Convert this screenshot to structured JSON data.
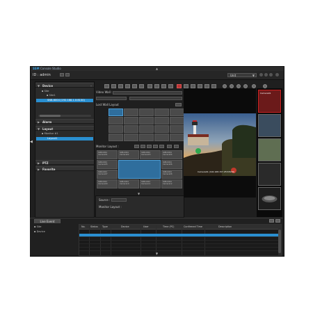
{
  "app": {
    "brand": "SSM",
    "title": "Console Studio",
    "id_label": "ID : admin",
    "language": "Unit"
  },
  "left_panel": {
    "device": {
      "header": "Device",
      "tree": [
        {
          "label": "Site"
        },
        {
          "label": "Site1"
        },
        {
          "label": "SNB-6004 (192.168.1.0:8130)",
          "selected": true
        }
      ]
    },
    "alarm": {
      "header": "Alarm"
    },
    "layout": {
      "header": "Layout",
      "items": [
        {
          "label": "Monitor #1"
        },
        {
          "label": "Layout1",
          "selected": true
        }
      ]
    },
    "ptz": {
      "header": "PTZ"
    },
    "favorite": {
      "header": "Favorite"
    }
  },
  "center": {
    "video_wall_label": "Video Wall :",
    "lost_wall_layout": "Lost Wall Layout",
    "monitor_layout_label": "Monitor Layout :",
    "monitor_cells": [
      "SNB-6004 Camera01",
      "SNB-6004 Camera02",
      "SNB-6004 Camera03",
      "SNB-6004 Camera04",
      "SNB-6004 Camera05",
      "SNB-6004 Camera06",
      "SNB-6004 Camera07",
      "SNB-6004 Camera08",
      "SNB-6004 Camera09",
      "SNB-6004 Camera10",
      "SNB-6004 Camera11",
      "SNB-6004 Camera12"
    ],
    "source_label": "Source :",
    "monitor_layout_footer": "Monitor Layout :"
  },
  "video": {
    "main_stamp": "Camera01 (192.168.157.253:8130)",
    "thumb_stamp": "Camera01"
  },
  "bottom": {
    "tab_label": "Live Event",
    "tree": [
      {
        "label": "Site"
      },
      {
        "label": "Device"
      }
    ],
    "columns": [
      "No.",
      "Status",
      "Type",
      "Device",
      "User",
      "Time (PC)",
      "Confirmed Time",
      "Description"
    ]
  },
  "colors": {
    "accent": "#2a8fd0",
    "background": "#1f1f1f",
    "panel": "#2a2a2a",
    "alarm_red": "#cc2222"
  }
}
